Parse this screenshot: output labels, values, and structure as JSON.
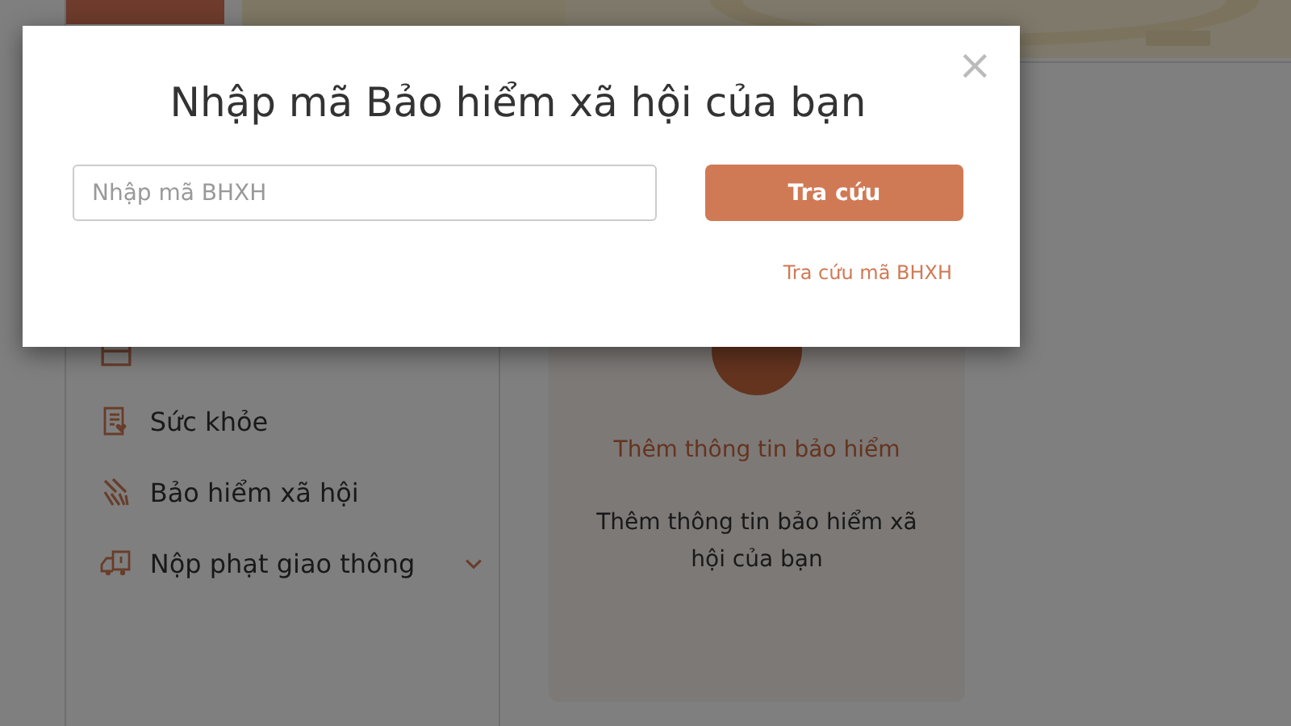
{
  "sidebar": {
    "items": [
      {
        "kind": "school",
        "expandable": false
      },
      {
        "label": "Sức khỏe",
        "kind": "health",
        "expandable": false
      },
      {
        "label": "Bảo hiểm xã hội",
        "kind": "insurance",
        "expandable": false
      },
      {
        "label": "Nộp phạt giao thông",
        "kind": "traffic",
        "expandable": true
      }
    ]
  },
  "card": {
    "title": "Thêm thông tin bảo hiểm",
    "description": "Thêm thông tin bảo hiểm xã hội của bạn"
  },
  "dialog": {
    "title": "Nhập mã Bảo hiểm xã hội của bạn",
    "close": "×",
    "input": {
      "placeholder": "Nhập mã BHXH"
    },
    "button": "Tra cứu",
    "link": "Tra cứu mã BHXH"
  }
}
